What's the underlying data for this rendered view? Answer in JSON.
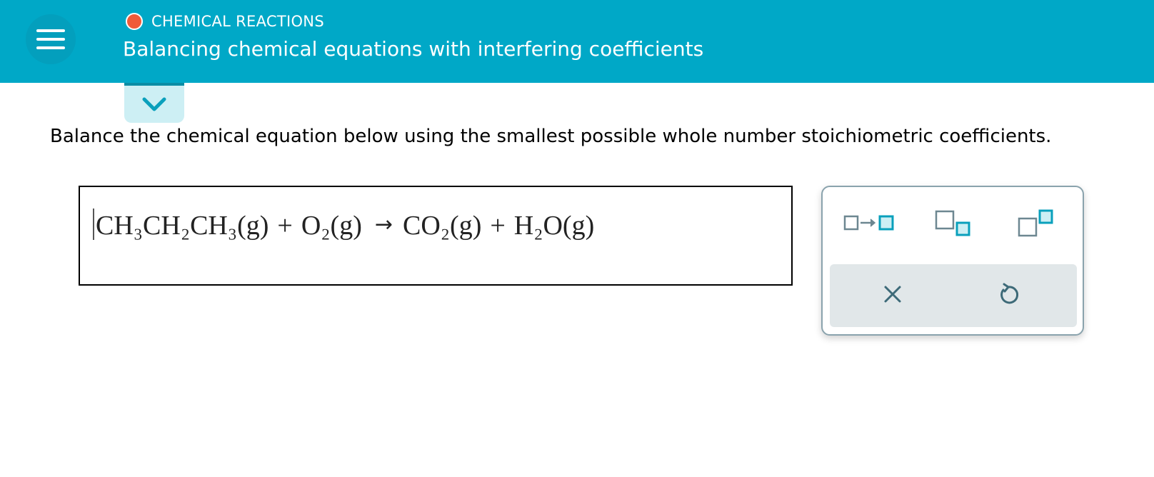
{
  "header": {
    "category": "CHEMICAL REACTIONS",
    "title": "Balancing chemical equations with interfering coefficients",
    "colors": {
      "bar": "#00a8c7",
      "dot": "#f05a38"
    }
  },
  "menu": {
    "icon": "hamburger-menu-icon"
  },
  "expand": {
    "icon": "chevron-down-icon"
  },
  "instruction": "Balance the chemical equation below using the smallest possible whole number stoichiometric coefficients.",
  "equation": {
    "reactants": [
      "CH₃CH₂CH₃(g)",
      "O₂(g)"
    ],
    "products": [
      "CO₂(g)",
      "H₂O(g)"
    ],
    "plus": "+",
    "arrow": "→"
  },
  "toolbar": {
    "tools": [
      "reaction-arrow-icon",
      "subscript-icon",
      "superscript-icon"
    ],
    "actions": [
      "clear-x-icon",
      "undo-icon"
    ]
  }
}
